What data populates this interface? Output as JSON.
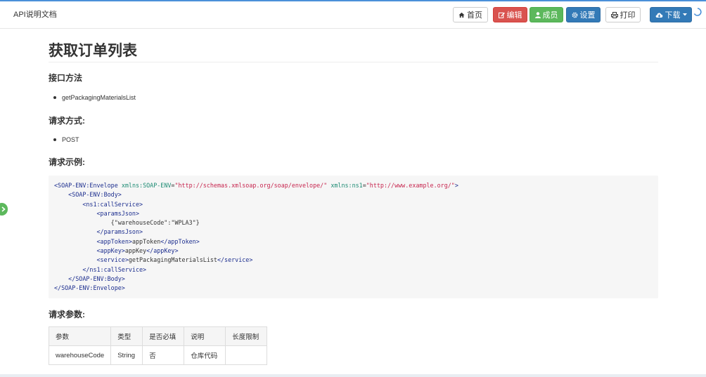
{
  "header": {
    "title": "API说明文档",
    "buttons": {
      "home": "首页",
      "edit": "编辑",
      "members": "成员",
      "settings": "设置",
      "print": "打印",
      "download": "下载"
    }
  },
  "page": {
    "title": "获取订单列表",
    "sections": {
      "method_heading": "接口方法",
      "method_value": "getPackagingMaterialsList",
      "request_type_heading": "请求方式:",
      "request_type_value": "POST",
      "example_heading": "请求示例:",
      "params_heading": "请求参数:"
    },
    "code": {
      "open_tag": "SOAP-ENV:Envelope",
      "attr1_name": "xmlns:SOAP-ENV",
      "attr1_value": "\"http://schemas.xmlsoap.org/soap/envelope/\"",
      "attr2_name": "xmlns:ns1",
      "attr2_value": "\"http://www.example.org/\"",
      "line2": "    <SOAP-ENV:Body>",
      "line3": "        <ns1:callService>",
      "line4": "            <paramsJson>",
      "line5": "                {\"warehouseCode\":\"WPLA3\"}",
      "line6": "            </paramsJson>",
      "line7_open": "            <appToken>",
      "line7_text": "appToken",
      "line7_close": "</appToken>",
      "line8_open": "            <appKey>",
      "line8_text": "appKey",
      "line8_close": "</appKey>",
      "line9_open": "            <service>",
      "line9_text": "getPackagingMaterialsList",
      "line9_close": "</service>",
      "line10": "        </ns1:callService>",
      "line11": "    </SOAP-ENV:Body>",
      "line12": "</SOAP-ENV:Envelope>"
    },
    "params_table": {
      "headers": [
        "参数",
        "类型",
        "是否必填",
        "说明",
        "长度限制"
      ],
      "rows": [
        [
          "warehouseCode",
          "String",
          "否",
          "仓库代码",
          ""
        ]
      ]
    }
  },
  "colors": {
    "edit": "#d9534f",
    "members": "#5cb85c",
    "settings": "#337ab7",
    "download": "#337ab7",
    "code_tag": "#1b2d8e",
    "code_attr": "#1c8b73",
    "code_string": "#c7254e"
  },
  "icons": {
    "home": "home-icon",
    "edit": "edit-icon",
    "members": "user-icon",
    "settings": "gear-icon",
    "print": "print-icon",
    "download": "cloud-download-icon",
    "side_toggle": "chevron-right-icon",
    "loading": "spinner-icon"
  }
}
